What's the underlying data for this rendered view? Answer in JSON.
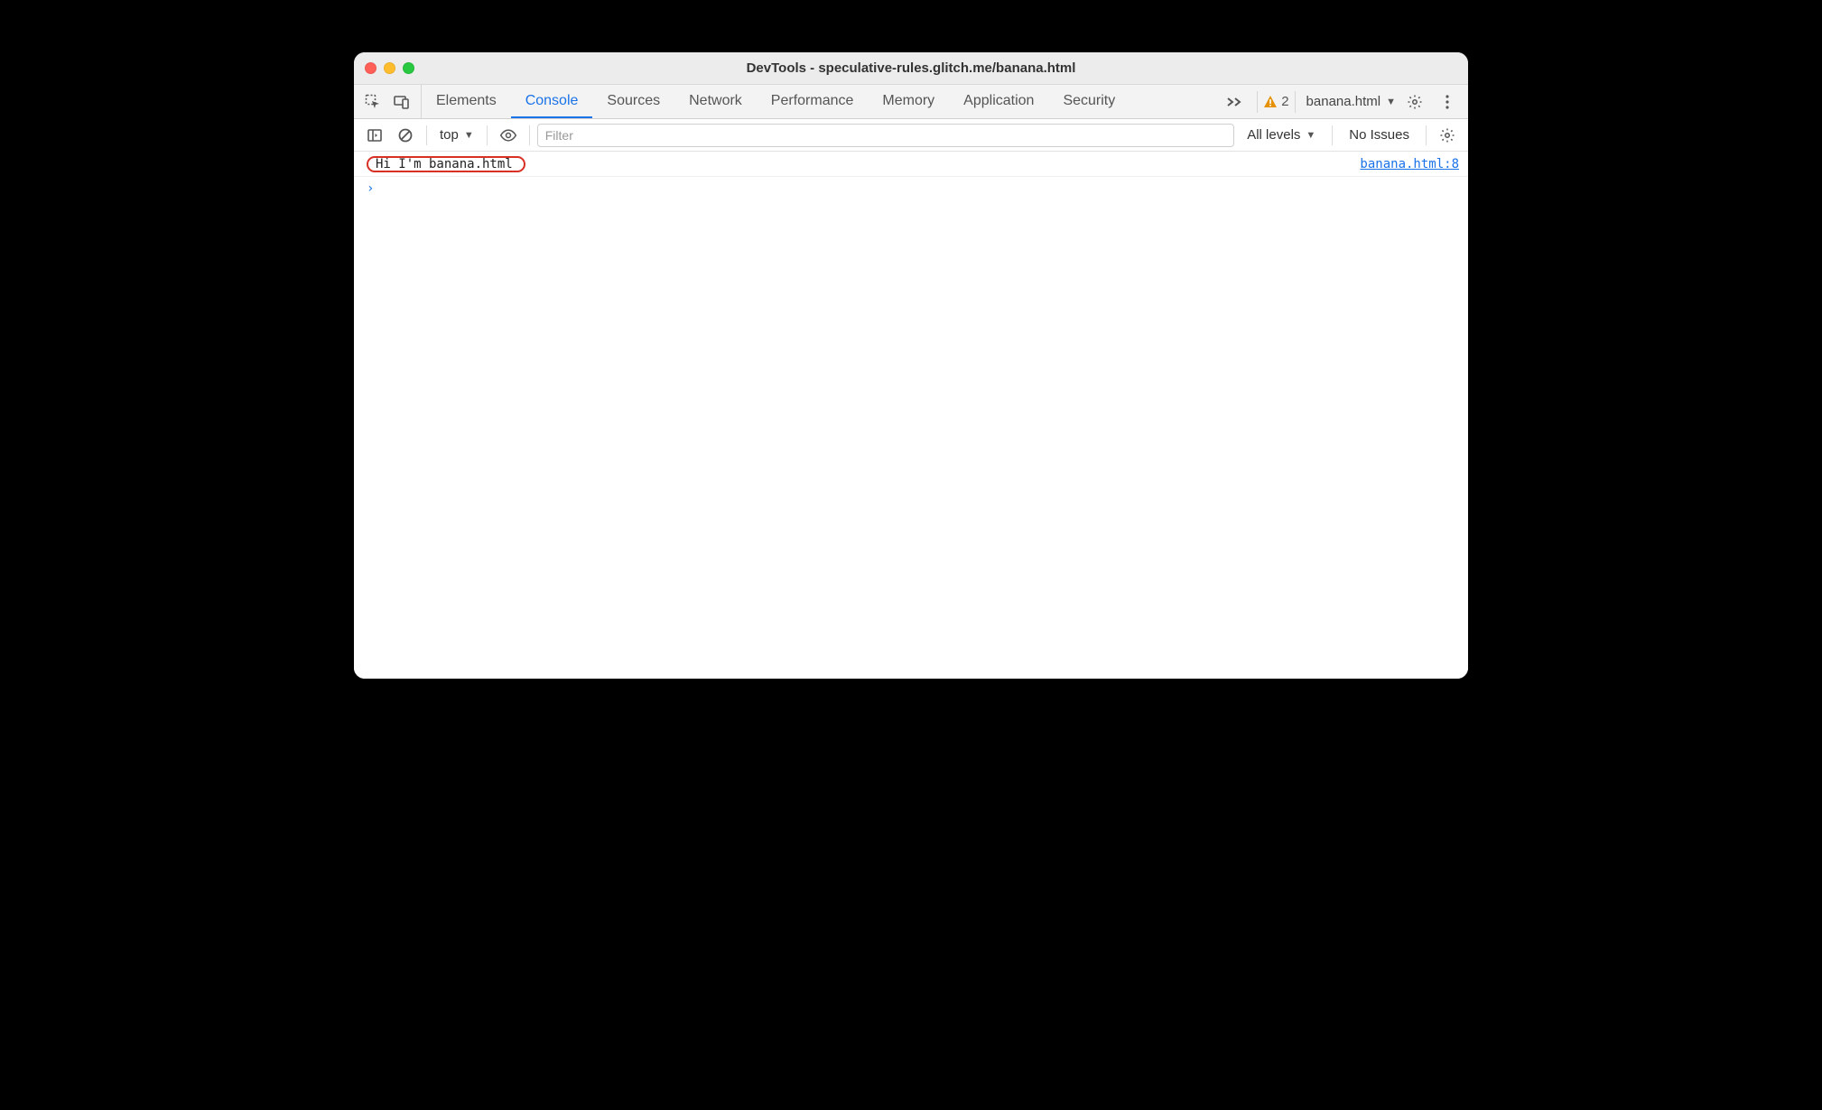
{
  "window": {
    "title": "DevTools - speculative-rules.glitch.me/banana.html"
  },
  "tabs": {
    "items": [
      "Elements",
      "Console",
      "Sources",
      "Network",
      "Performance",
      "Memory",
      "Application",
      "Security"
    ],
    "active_index": 1,
    "warning_count": "2",
    "target_label": "banana.html"
  },
  "toolbar": {
    "context_label": "top",
    "filter_placeholder": "Filter",
    "levels_label": "All levels",
    "issues_label": "No Issues"
  },
  "console": {
    "rows": [
      {
        "message": "Hi I'm banana.html",
        "source": "banana.html:8"
      }
    ]
  }
}
